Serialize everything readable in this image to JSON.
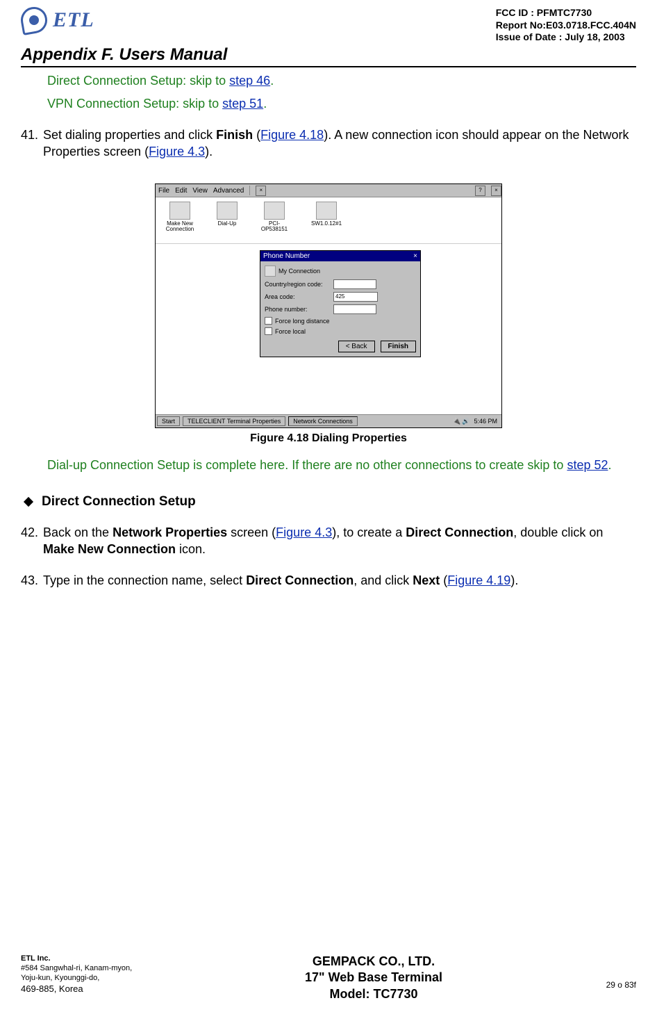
{
  "header": {
    "logo_text": "ETL",
    "fcc_id": "FCC ID : PFMTC7730",
    "report_no": "Report No:E03.0718.FCC.404N",
    "issue_date": "Issue of Date : July 18, 2003",
    "appendix": "Appendix F.  Users Manual"
  },
  "body": {
    "direct_conn_prefix": "Direct Connection Setup: skip to ",
    "direct_conn_link": "step 46",
    "direct_conn_suffix": ".",
    "vpn_conn_prefix": "VPN Connection Setup: skip to ",
    "vpn_conn_link": "step 51",
    "vpn_conn_suffix": ".",
    "step41_num": "41.",
    "step41_a": "Set dialing properties and click ",
    "step41_b_bold": "Finish",
    "step41_c": " (",
    "step41_link1": "Figure 4.18",
    "step41_d": ").  A new connection icon should appear on the Network Properties screen (",
    "step41_link2": "Figure 4.3",
    "step41_e": ").",
    "fig_caption": "Figure 4.18       Dialing Properties",
    "after_fig_a": "Dial-up Connection Setup is complete here.  If there are no other connections to create skip to  ",
    "after_fig_link": "step 52",
    "after_fig_b": ".",
    "section_head": "Direct Connection Setup",
    "step42_num": "42.",
    "step42_a": "Back on the ",
    "step42_b_bold": "Network Properties",
    "step42_c": " screen (",
    "step42_link": "Figure 4.3",
    "step42_d": "), to create a ",
    "step42_e_bold": "Direct Connection",
    "step42_f": ", double click on ",
    "step42_g_bold": "Make New Connection",
    "step42_h": " icon.",
    "step43_num": "43.",
    "step43_a": "Type in the connection name, select ",
    "step43_b_bold": "Direct Connection",
    "step43_c": ", and click ",
    "step43_d_bold": "Next",
    "step43_e": " (",
    "step43_link": "Figure 4.19",
    "step43_f": ")."
  },
  "screenshot": {
    "menu": {
      "file": "File",
      "edit": "Edit",
      "view": "View",
      "adv": "Advanced"
    },
    "icons": {
      "i1": "Make New Connection",
      "i2": "Dial-Up",
      "i3": "PCI-OP538151",
      "i4": "SW1.0.12#1"
    },
    "dialog": {
      "title": "Phone Number",
      "conn": "My Connection",
      "country": "Country/region code:",
      "area": "Area code:",
      "area_val": "425",
      "phone": "Phone number:",
      "force_long": "Force long distance",
      "force_local": "Force local",
      "back": "< Back",
      "finish": "Finish"
    },
    "taskbar": {
      "start": "Start",
      "t1": "TELECLIENT Terminal Properties",
      "t2": "Network Connections",
      "clock": "5:46 PM"
    }
  },
  "footer": {
    "company": "ETL Inc.",
    "addr1": "#584 Sangwhal-ri, Kanam-myon,",
    "addr2": "Yoju-kun, Kyounggi-do,",
    "addr3": "469-885, Korea",
    "center1": "GEMPACK CO., LTD.",
    "center2": "17\" Web Base Terminal",
    "center3": "Model: TC7730",
    "page": "29 o 83f"
  }
}
